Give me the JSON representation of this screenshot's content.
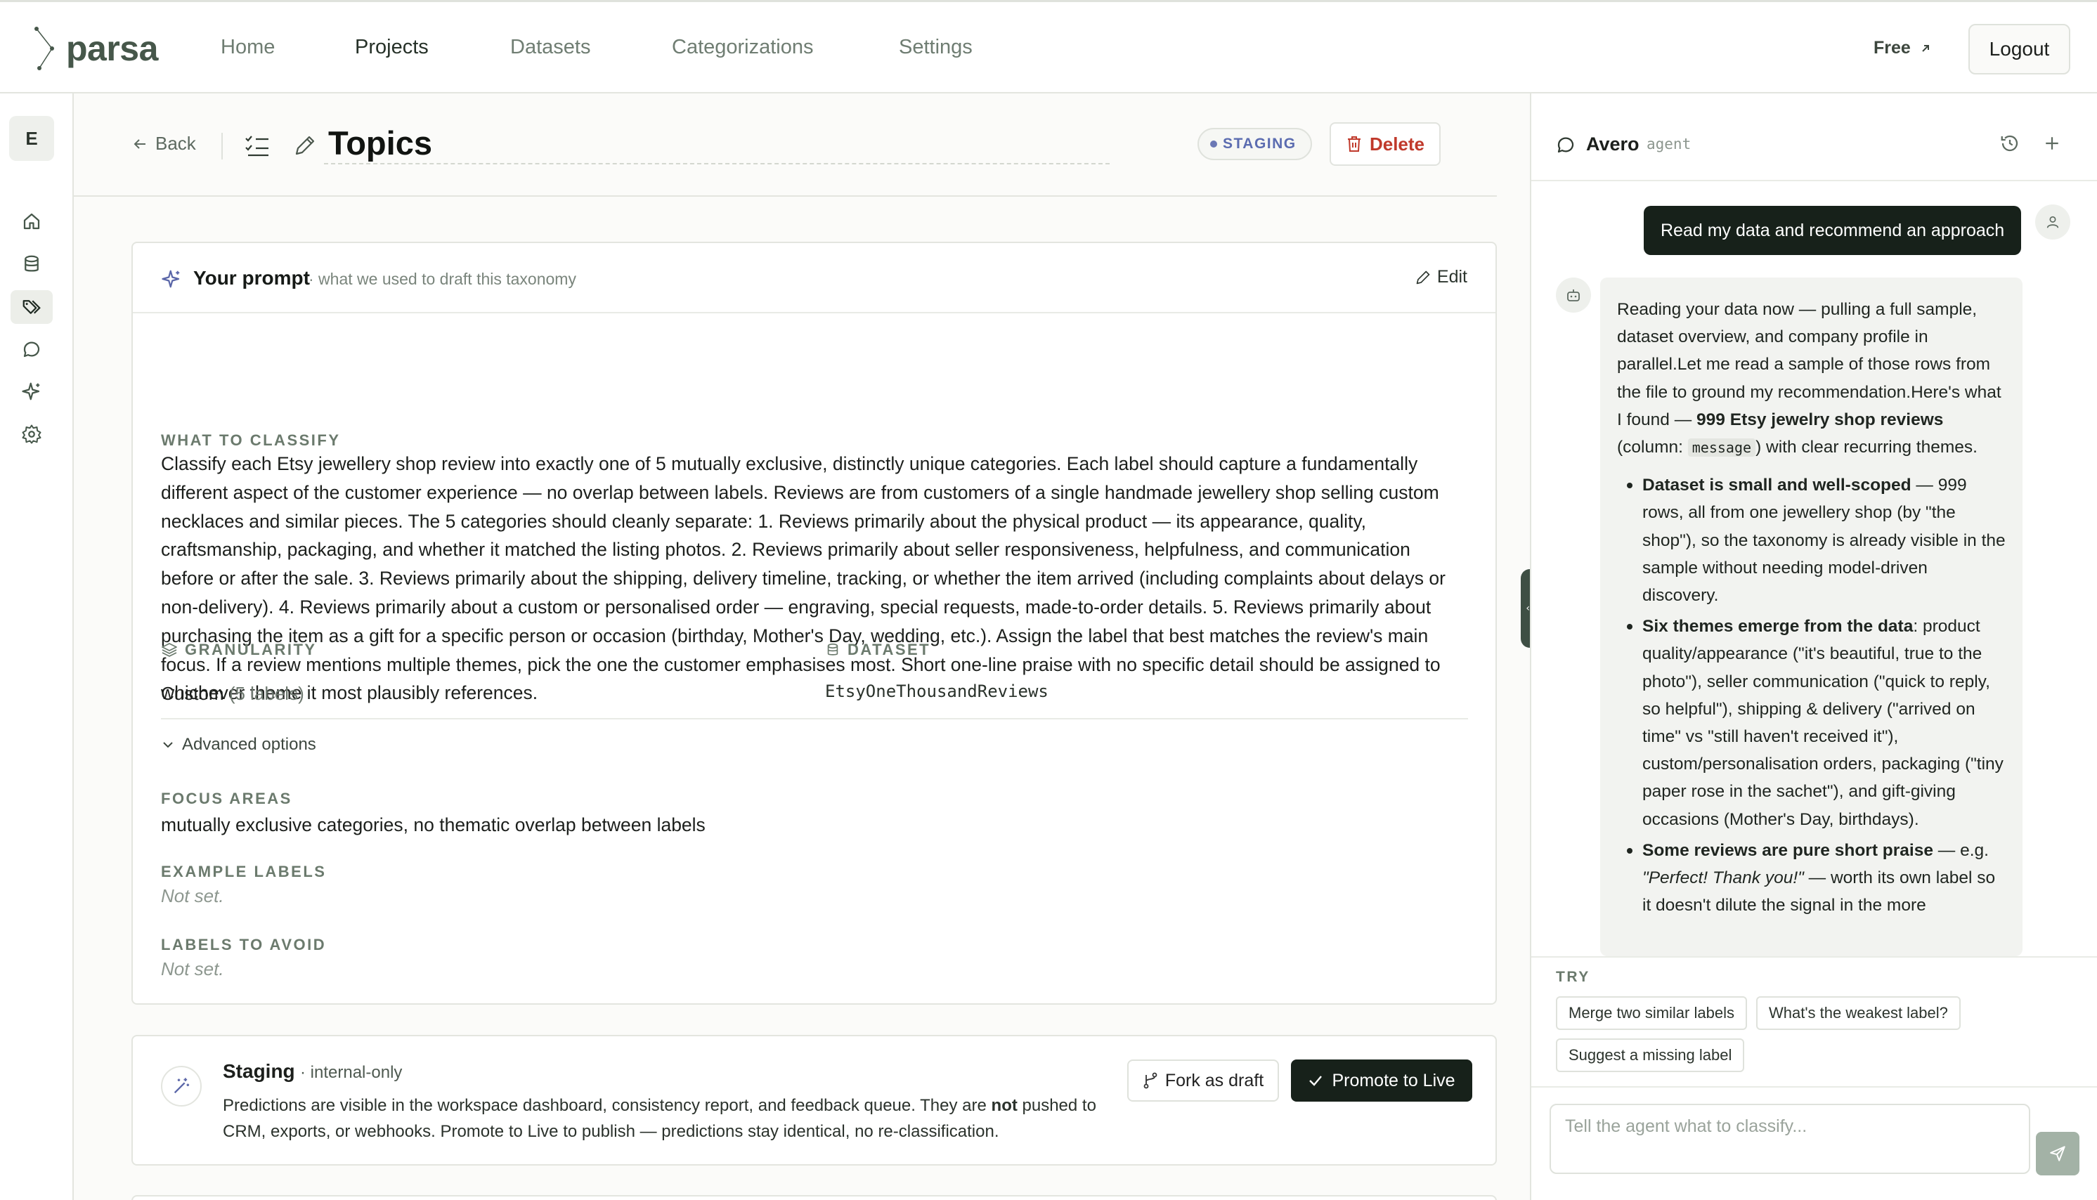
{
  "app": {
    "brand": "parsa"
  },
  "nav": {
    "items": [
      {
        "label": "Home"
      },
      {
        "label": "Projects"
      },
      {
        "label": "Datasets"
      },
      {
        "label": "Categorizations"
      },
      {
        "label": "Settings"
      }
    ],
    "plan_label": "Free",
    "logout_label": "Logout"
  },
  "rail": {
    "avatar_initial": "E",
    "icons": [
      "home-icon",
      "database-icon",
      "tags-icon",
      "chat-icon",
      "sparkle-icon",
      "gear-icon"
    ]
  },
  "page": {
    "back_label": "Back",
    "title": "Topics",
    "status_badge": "STAGING",
    "delete_label": "Delete"
  },
  "prompt": {
    "title": "Your prompt",
    "subtitle": "· what we used to draft this taxonomy",
    "edit_label": "Edit",
    "what_label": "WHAT TO CLASSIFY",
    "what_text": "Classify each Etsy jewellery shop review into exactly one of 5 mutually exclusive, distinctly unique categories. Each label should capture a fundamentally different aspect of the customer experience — no overlap between labels. Reviews are from customers of a single handmade jewellery shop selling custom necklaces and similar pieces. The 5 categories should cleanly separate: 1. Reviews primarily about the physical product — its appearance, quality, craftsmanship, packaging, and whether it matched the listing photos. 2. Reviews primarily about seller responsiveness, helpfulness, and communication before or after the sale. 3. Reviews primarily about the shipping, delivery timeline, tracking, or whether the item arrived (including complaints about delays or non-delivery). 4. Reviews primarily about a custom or personalised order — engraving, special requests, made-to-order details. 5. Reviews primarily about purchasing the item as a gift for a specific person or occasion (birthday, Mother's Day, wedding, etc.). Assign the label that best matches the review's main focus. If a review mentions multiple themes, pick the one the customer emphasises most. Short one-line praise with no specific detail should be assigned to whichever theme it most plausibly references.",
    "granularity_label": "GRANULARITY",
    "granularity_value": "Custom",
    "granularity_count": "(5 labels)",
    "dataset_label": "DATASET",
    "dataset_value": "EtsyOneThousandReviews",
    "advanced_label": "Advanced options",
    "focus_label": "FOCUS AREAS",
    "focus_value": "mutually exclusive categories, no thematic overlap between labels",
    "examples_label": "EXAMPLE LABELS",
    "examples_value": "Not set.",
    "avoid_label": "LABELS TO AVOID",
    "avoid_value": "Not set."
  },
  "staging": {
    "title": "Staging",
    "subtitle": "· internal-only",
    "text_before": "Predictions are visible in the workspace dashboard, consistency report, and feedback queue. They are ",
    "text_bold": "not",
    "text_after": " pushed to CRM, exports, or webhooks. Promote to Live to publish — predictions stay identical, no re-classification.",
    "fork_label": "Fork as draft",
    "promote_label": "Promote to Live"
  },
  "agent": {
    "name": "Avero",
    "role": "agent",
    "user_message": "Read my data and recommend an approach",
    "reply": {
      "intro": "Reading your data now — pulling a full sample, dataset overview, and company profile in parallel.Let me read a sample of those rows from the file to ground my recommendation.Here's what I found — ",
      "intro_bold": "999 Etsy jewelry shop reviews",
      "intro_mid": " (column: ",
      "intro_code": "message",
      "intro_end": ") with clear recurring themes.",
      "bullets": [
        {
          "bold": "Dataset is small and well-scoped",
          "text": " — 999 rows, all from one jewellery shop (by \"the shop\"), so the taxonomy is already visible in the sample without needing model-driven discovery."
        },
        {
          "bold": "Six themes emerge from the data",
          "text": ": product quality/appearance (\"it's beautiful, true to the photo\"), seller communication (\"quick to reply, so helpful\"), shipping & delivery (\"arrived on time\" vs \"still haven't received it\"), custom/personalisation orders, packaging (\"tiny paper rose in the sachet\"), and gift-giving occasions (Mother's Day, birthdays)."
        },
        {
          "bold": "Some reviews are pure short praise",
          "text": " — e.g. ",
          "italic": "\"Perfect! Thank you!\"",
          "tail": " — worth its own label so it doesn't dilute the signal in the more"
        }
      ]
    },
    "try_label": "TRY",
    "suggestions": [
      "Merge two similar labels",
      "What's the weakest label?",
      "Suggest a missing label"
    ],
    "composer_placeholder": "Tell the agent what to classify..."
  }
}
